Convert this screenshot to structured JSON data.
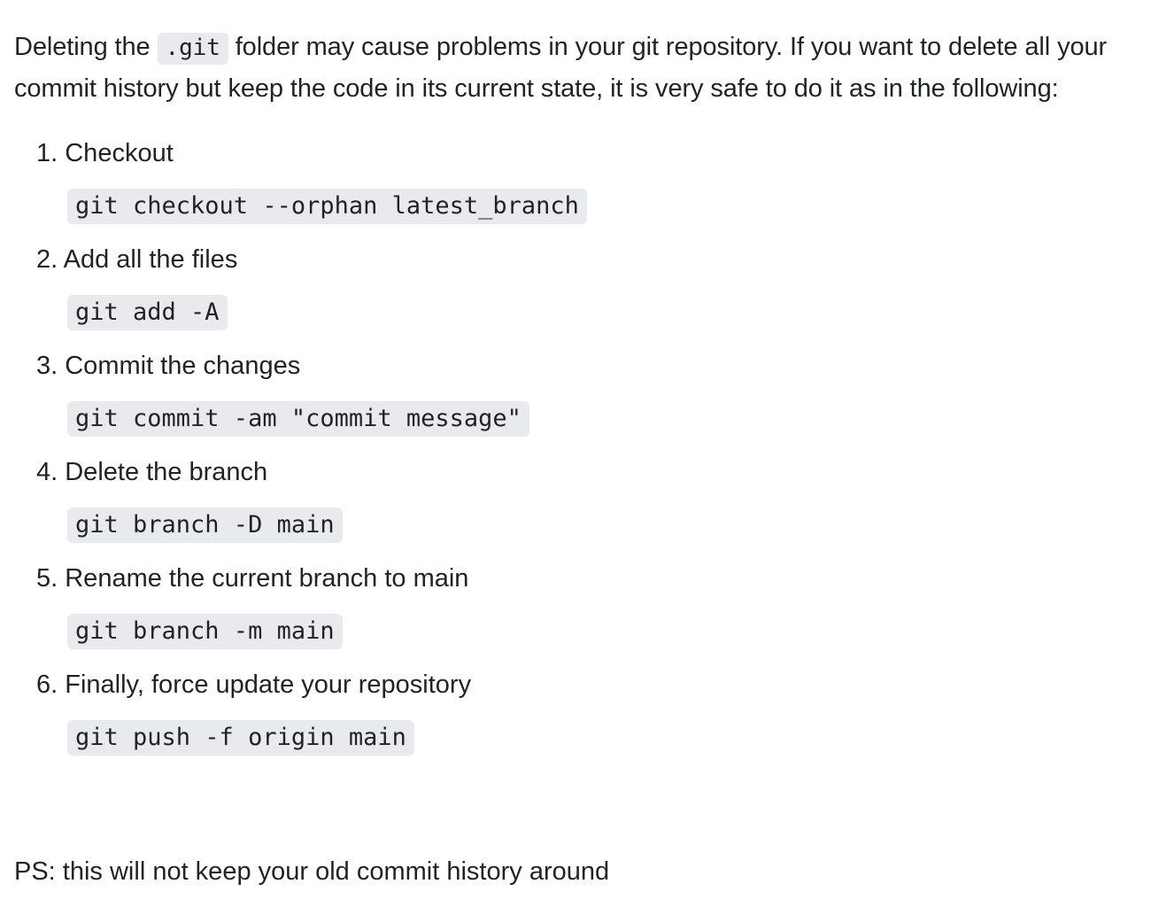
{
  "intro": {
    "before": "Deleting the ",
    "code": ".git",
    "after": " folder may cause problems in your git repository. If you want to delete all your commit history but keep the code in its current state, it is very safe to do it as in the following:"
  },
  "steps": [
    {
      "title": "1. Checkout",
      "code": "git checkout --orphan latest_branch"
    },
    {
      "title": "2. Add all the files",
      "code": "git add -A"
    },
    {
      "title": "3. Commit the changes",
      "code": "git commit -am \"commit message\""
    },
    {
      "title": "4. Delete the branch",
      "code": "git branch -D main"
    },
    {
      "title": "5. Rename the current branch to main",
      "code": "git branch -m main"
    },
    {
      "title": "6. Finally, force update your repository",
      "code": "git push -f origin main"
    }
  ],
  "ps": "PS: this will not keep your old commit history around"
}
